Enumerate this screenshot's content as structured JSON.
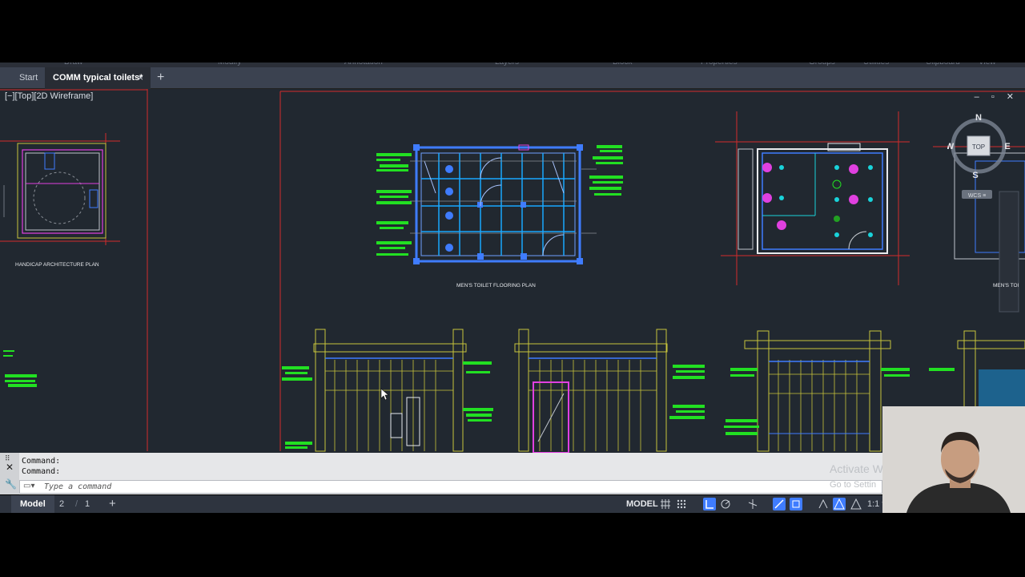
{
  "ribbon": {
    "panels": [
      "Draw",
      "Modify",
      "Annotation",
      "Layers",
      "Block",
      "Properties",
      "Groups",
      "Utilities",
      "Clipboard",
      "View"
    ]
  },
  "tabs": {
    "start": "Start",
    "active": "COMM typical toilets*",
    "close": "×",
    "add": "+"
  },
  "viewport": {
    "label": "[−][Top][2D Wireframe]",
    "controls": "‒ ▫ ✕"
  },
  "drawing": {
    "labels": {
      "handicap_plan": "HANDICAP ARCHITECTURE PLAN",
      "mens_flooring": "MEN'S TOILET FLOORING PLAN",
      "mens_right": "MEN'S TOI"
    },
    "colors": {
      "background": "#212830",
      "frame": "#d22b2b",
      "walls": "#3f7cff",
      "annotations": "#22e022",
      "elevation": "#c8c43c",
      "accent_magenta": "#e040e0",
      "cyan": "#19d3da"
    }
  },
  "viewcube": {
    "north": "N",
    "south": "S",
    "east": "E",
    "west": "W",
    "face": "TOP",
    "wcs": "WCS ≡"
  },
  "command": {
    "history": [
      "Command:",
      "Command:"
    ],
    "placeholder": "Type a command",
    "watermark_line1": "Activate W",
    "watermark_line2": "Go to Settin"
  },
  "statusbar": {
    "model_tab": "Model",
    "layout_2": "2",
    "separator": "/",
    "layout_1": "1",
    "add": "+",
    "space": "MODEL",
    "scale": "1:1 ▾",
    "icons": [
      "grid-icon",
      "snap-icon",
      "ortho-icon",
      "polar-icon",
      "isodraft-icon",
      "osnap-track-icon",
      "osnap-icon",
      "selection-cycling-icon",
      "annotation-scale-icon",
      "annotation-visibility-icon",
      "autoscale-icon"
    ]
  }
}
